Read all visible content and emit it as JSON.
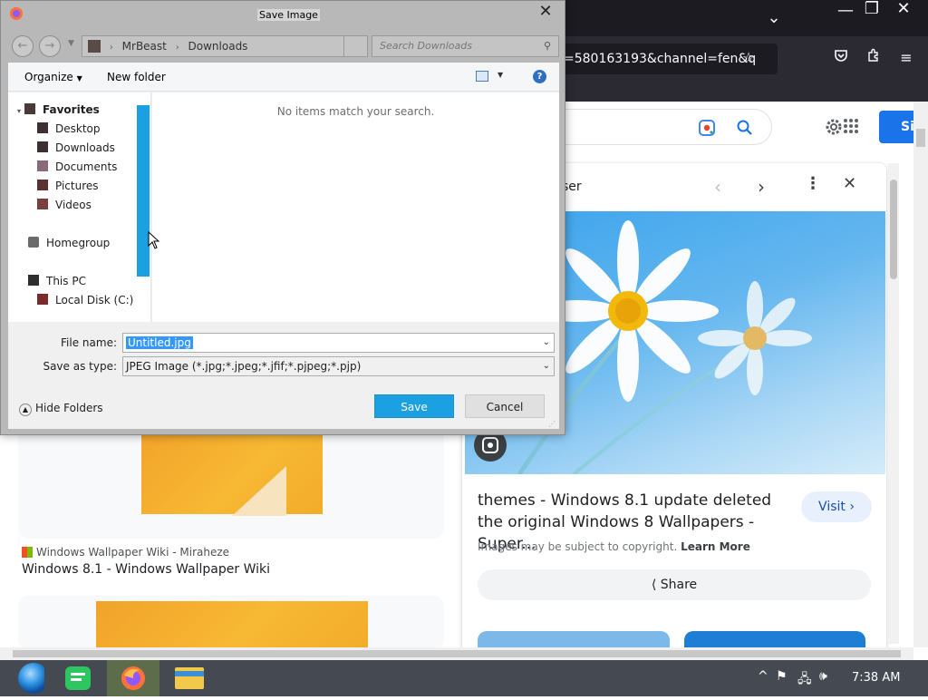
{
  "browser": {
    "url_fragment": "=580163193&channel=fen&q",
    "window_controls": {
      "minimize": "—",
      "restore": "❐",
      "close": "✕"
    },
    "tabs_dropdown": "⌄"
  },
  "google": {
    "signin_label": "Si",
    "preview": {
      "header_partial": "ser",
      "title": "themes - Windows 8.1 update deleted the original Windows 8 Wallpapers - Super...",
      "visit_label": "Visit",
      "copyright": "Images may be subject to copyright.",
      "learn_more": "Learn More",
      "share_label": "Share"
    },
    "result": {
      "source": "Windows Wallpaper Wiki - Miraheze",
      "title": "Windows 8.1 - Windows Wallpaper Wiki"
    }
  },
  "dialog": {
    "title": "Save Image",
    "breadcrumb": [
      "MrBeast",
      "Downloads"
    ],
    "search_placeholder": "Search Downloads",
    "toolbar": {
      "organize": "Organize",
      "new_folder": "New folder"
    },
    "nav": {
      "favorites": "Favorites",
      "favorites_items": [
        "Desktop",
        "Downloads",
        "Documents",
        "Pictures",
        "Videos"
      ],
      "homegroup": "Homegroup",
      "this_pc": "This PC",
      "drives": [
        "Local Disk (C:)"
      ]
    },
    "empty_message": "No items match your search.",
    "file_name_label": "File name:",
    "file_name_value": "Untitled.jpg",
    "save_as_type_label": "Save as type:",
    "save_as_type_value": "JPEG Image (*.jpg;*.jpeg;*.jfif;*.pjpeg;*.pjp)",
    "save_label": "Save",
    "cancel_label": "Cancel",
    "hide_folders_label": "Hide Folders"
  },
  "taskbar": {
    "clock": "7:38 AM"
  }
}
